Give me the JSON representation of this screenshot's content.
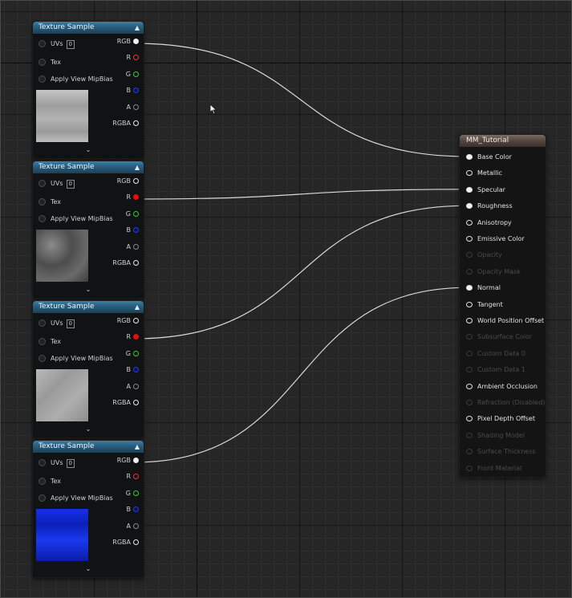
{
  "texture_nodes": [
    {
      "title": "Texture Sample",
      "uvs_label": "UVs",
      "uvs_value": "0",
      "tex_label": "Tex",
      "mip_label": "Apply View MipBias",
      "outputs": [
        "RGB",
        "R",
        "G",
        "B",
        "A",
        "RGBA"
      ],
      "connected_output": "RGB",
      "thumbnail": "gray concrete texture",
      "collapse_icon": "chevron-up-icon",
      "expand_icon": "chevron-down-icon"
    },
    {
      "title": "Texture Sample",
      "uvs_label": "UVs",
      "uvs_value": "0",
      "tex_label": "Tex",
      "mip_label": "Apply View MipBias",
      "outputs": [
        "RGB",
        "R",
        "G",
        "B",
        "A",
        "RGBA"
      ],
      "connected_output": "R",
      "thumbnail": "dark gray rough texture",
      "collapse_icon": "chevron-up-icon",
      "expand_icon": "chevron-down-icon"
    },
    {
      "title": "Texture Sample",
      "uvs_label": "UVs",
      "uvs_value": "0",
      "tex_label": "Tex",
      "mip_label": "Apply View MipBias",
      "outputs": [
        "RGB",
        "R",
        "G",
        "B",
        "A",
        "RGBA"
      ],
      "connected_output": "R",
      "thumbnail": "light gray texture",
      "collapse_icon": "chevron-up-icon",
      "expand_icon": "chevron-down-icon"
    },
    {
      "title": "Texture Sample",
      "uvs_label": "UVs",
      "uvs_value": "0",
      "tex_label": "Tex",
      "mip_label": "Apply View MipBias",
      "outputs": [
        "RGB",
        "R",
        "G",
        "B",
        "A",
        "RGBA"
      ],
      "connected_output": "RGB",
      "thumbnail": "blue normal map texture",
      "collapse_icon": "chevron-up-icon",
      "expand_icon": "chevron-down-icon"
    }
  ],
  "material_node": {
    "title": "MM_Tutorial",
    "inputs": [
      {
        "label": "Base Color",
        "enabled": true,
        "connected": true
      },
      {
        "label": "Metallic",
        "enabled": true,
        "connected": false
      },
      {
        "label": "Specular",
        "enabled": true,
        "connected": true
      },
      {
        "label": "Roughness",
        "enabled": true,
        "connected": true
      },
      {
        "label": "Anisotropy",
        "enabled": true,
        "connected": false
      },
      {
        "label": "Emissive Color",
        "enabled": true,
        "connected": false
      },
      {
        "label": "Opacity",
        "enabled": false,
        "connected": false
      },
      {
        "label": "Opacity Mask",
        "enabled": false,
        "connected": false
      },
      {
        "label": "Normal",
        "enabled": true,
        "connected": true
      },
      {
        "label": "Tangent",
        "enabled": true,
        "connected": false
      },
      {
        "label": "World Position Offset",
        "enabled": true,
        "connected": false
      },
      {
        "label": "Subsurface Color",
        "enabled": false,
        "connected": false
      },
      {
        "label": "Custom Data 0",
        "enabled": false,
        "connected": false
      },
      {
        "label": "Custom Data 1",
        "enabled": false,
        "connected": false
      },
      {
        "label": "Ambient Occlusion",
        "enabled": true,
        "connected": false
      },
      {
        "label": "Refraction (Disabled)",
        "enabled": false,
        "connected": false
      },
      {
        "label": "Pixel Depth Offset",
        "enabled": true,
        "connected": false
      },
      {
        "label": "Shading Model",
        "enabled": false,
        "connected": false
      },
      {
        "label": "Surface Thickness",
        "enabled": false,
        "connected": false
      },
      {
        "label": "Front Material",
        "enabled": false,
        "connected": false
      }
    ]
  },
  "connections": [
    {
      "from_node": 0,
      "from_pin": "RGB",
      "to_input": "Base Color"
    },
    {
      "from_node": 1,
      "from_pin": "R",
      "to_input": "Specular"
    },
    {
      "from_node": 2,
      "from_pin": "R",
      "to_input": "Roughness"
    },
    {
      "from_node": 3,
      "from_pin": "RGB",
      "to_input": "Normal"
    }
  ],
  "colors": {
    "canvas": "#262626",
    "texture_header": "#2a5f80",
    "material_header": "#54463f",
    "wire": "#d9d9d9",
    "pin_red": "#e01010",
    "pin_green": "#33cc33",
    "pin_blue": "#223dd8"
  }
}
